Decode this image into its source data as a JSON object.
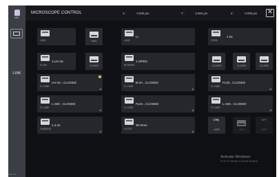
{
  "sidebar": {
    "logo_label": "MIC",
    "link_label": "LINK",
    "footer": "Dru. Cli"
  },
  "header": {
    "title": "MICROSCOPE CONTROL",
    "x_axis": "X :",
    "x_value": "0.000 µm",
    "y_axis": "Y :",
    "y_value": "0.000 µm",
    "z_axis": "Z :",
    "z_value": "0.000 µm",
    "close_glyph": "✕"
  },
  "tiles": {
    "load1": {
      "caption": "LOAD"
    },
    "save": {
      "caption": "SAVE"
    },
    "load2": {
      "caption": "LOAD",
      "value": "LI"
    },
    "zoom": {
      "caption": "ZOOM",
      "value": "1.0x"
    },
    "fldia": {
      "caption": "FL.DIA",
      "value": "1.UV-1K"
    },
    "closed1": {
      "caption": "CLOSED"
    },
    "bfwheel": {
      "caption": "BF.WHEEL",
      "value": "1.OPEN"
    },
    "closed_a": {
      "caption": "CLOSED"
    },
    "closed_b": {
      "caption": "CLOSED"
    },
    "closed_c": {
      "caption": "CLOSED"
    },
    "flcube1": {
      "caption": "FL.CUBE",
      "value": "UV-1K , CLOSED"
    },
    "flcube2": {
      "caption": "FL.CUBE",
      "value": "B-2A , CLOSED"
    },
    "flcube3": {
      "caption": "FL.CUBE",
      "value": "FL03 , CLOSED"
    },
    "flcube4": {
      "caption": "FL.CUBE",
      "value": "L-450 , CLOSED"
    },
    "flcube5": {
      "caption": "FL.CUBE",
      "value": "FL01 , CLOSED"
    },
    "flcube6": {
      "caption": "FL.CUBE",
      "value": "L-425 , CLOSED"
    },
    "condenser": {
      "caption": "CONDENS.",
      "value": "1.2.4x"
    },
    "astop": {
      "caption": "A.STOP",
      "value": "30.0mm"
    },
    "ctrl_lamp": {
      "title": "CTRL",
      "caption": "LAMP"
    },
    "lamp2": {
      "caption": "LAMP"
    },
    "lamp3": {
      "caption": "LAMP",
      "title": "OFF"
    }
  },
  "watermark": {
    "line1": "Activate Windows",
    "line2": "Go to PC settings to activate Windows."
  }
}
